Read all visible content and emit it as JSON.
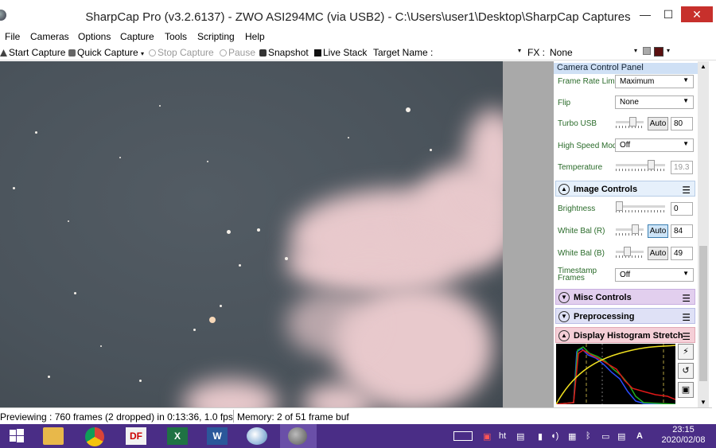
{
  "window": {
    "title": "SharpCap Pro (v3.2.6137) - ZWO ASI294MC (via USB2) - C:\\Users\\user1\\Desktop\\SharpCap Captures",
    "minimize": "—",
    "maximize": "☐",
    "close": "✕"
  },
  "menu": [
    "File",
    "Cameras",
    "Options",
    "Capture",
    "Tools",
    "Scripting",
    "Help"
  ],
  "toolbar": {
    "start_capture": "Start Capture",
    "quick_capture": "Quick Capture",
    "stop_capture": "Stop Capture",
    "pause": "Pause",
    "snapshot": "Snapshot",
    "live_stack": "Live Stack",
    "target_name_label": "Target Name :",
    "target_name_value": "",
    "fx_label": "FX :",
    "fx_value": "None"
  },
  "panel": {
    "title": "Camera Control Panel",
    "camera_rows": [
      {
        "label": "Frame Rate Limit",
        "value": "Maximum"
      },
      {
        "label": "Flip",
        "value": "None"
      },
      {
        "label": "Turbo USB",
        "auto": "Auto",
        "value": "80"
      },
      {
        "label": "High Speed Mode",
        "value": "Off"
      },
      {
        "label": "Temperature",
        "value": "19.3"
      }
    ],
    "image_controls": {
      "title": "Image Controls",
      "brightness": {
        "label": "Brightness",
        "value": "0"
      },
      "white_bal_r": {
        "label": "White Bal (R)",
        "auto": "Auto",
        "value": "84"
      },
      "white_bal_b": {
        "label": "White Bal (B)",
        "auto": "Auto",
        "value": "49"
      },
      "timestamp": {
        "label": "Timestamp Frames",
        "value": "Off"
      }
    },
    "sections": {
      "misc": "Misc Controls",
      "preprocessing": "Preprocessing",
      "histogram": "Display Histogram Stretch"
    },
    "colors": {
      "misc": "#e2cfee",
      "preprocessing": "#dfe1f6",
      "histogram": "#f5cfd7",
      "image_controls": "#e6f0fb"
    }
  },
  "status": {
    "preview": "Previewing : 760 frames (2 dropped) in 0:13:36, 1.0 fps",
    "memory": "Memory: 2 of 51 frame buf"
  },
  "taskbar": {
    "apps": [
      "windows-start",
      "file-explorer",
      "chrome",
      "pdf-reader",
      "excel",
      "word",
      "paint",
      "sharpcap"
    ],
    "tray_lang": "A",
    "time": "23:15",
    "date": "2020/02/08",
    "accent": "#4a2d86"
  }
}
